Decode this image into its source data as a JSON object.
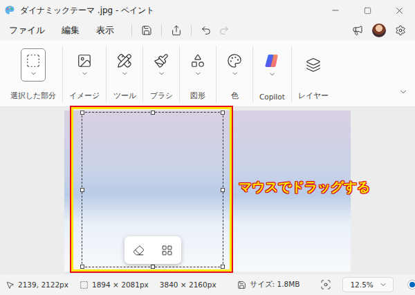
{
  "window": {
    "title": "ダイナミックテーマ .jpg - ペイント"
  },
  "menu": [
    {
      "label": "ファイル"
    },
    {
      "label": "編集"
    },
    {
      "label": "表示"
    }
  ],
  "quick_actions": [
    {
      "kind": "save",
      "disabled": false
    },
    {
      "kind": "share",
      "disabled": false
    },
    {
      "kind": "undo",
      "disabled": false
    },
    {
      "kind": "redo",
      "disabled": true
    }
  ],
  "ribbon": {
    "groups": [
      {
        "label": "選択した部分",
        "kind": "selection",
        "selected": true,
        "dropdown": true
      },
      {
        "label": "イメージ",
        "kind": "image",
        "selected": false,
        "dropdown": true
      },
      {
        "label": "ツール",
        "kind": "tools",
        "selected": false,
        "dropdown": true
      },
      {
        "label": "ブラシ",
        "kind": "brush",
        "selected": false,
        "dropdown": true
      },
      {
        "label": "図形",
        "kind": "shapes",
        "selected": false,
        "dropdown": true
      },
      {
        "label": "色",
        "kind": "color",
        "selected": false,
        "dropdown": true
      },
      {
        "label": "Copilot",
        "kind": "copilot",
        "selected": false,
        "dropdown": true
      },
      {
        "label": "レイヤー",
        "kind": "layers",
        "selected": false,
        "dropdown": false
      }
    ]
  },
  "annotation": {
    "text": "マウスでドラッグする"
  },
  "status_bar": {
    "cursor": "2139, 2122px",
    "selection": "1894 × 2081px",
    "image_size": "3840 × 2160px",
    "file_size": "サイズ: 1.8MB",
    "zoom": "12.5%",
    "zoom_level": 0.04
  }
}
